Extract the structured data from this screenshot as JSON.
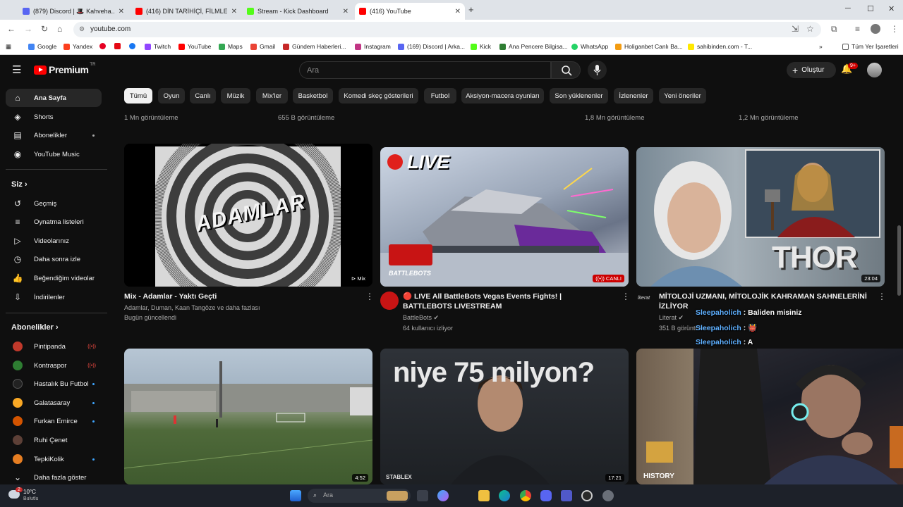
{
  "browser": {
    "tabs": [
      {
        "title": "(879) Discord | 🎩 Kahveha...",
        "color": "#5865f2",
        "active": false
      },
      {
        "title": "(416) DİN TARİHİÇİ, FİLMLERİ...",
        "color": "#ff0000",
        "active": false
      },
      {
        "title": "Stream - Kick Dashboard",
        "color": "#53fc18",
        "active": false
      },
      {
        "title": "(416) YouTube",
        "color": "#ff0000",
        "active": true
      }
    ],
    "new_tab": "+",
    "url": "youtube.com",
    "bookmarks": [
      {
        "label": "Google",
        "color": "#4285f4"
      },
      {
        "label": "Yandex",
        "color": "#fc3f1d"
      },
      {
        "label": "",
        "color": "#e60023"
      },
      {
        "label": "",
        "color": "#e50914"
      },
      {
        "label": "",
        "color": "#1877f2"
      },
      {
        "label": "Twitch",
        "color": "#9146ff"
      },
      {
        "label": "YouTube",
        "color": "#ff0000"
      },
      {
        "label": "Maps",
        "color": "#34a853"
      },
      {
        "label": "Gmail",
        "color": "#ea4335"
      },
      {
        "label": "Gündem Haberleri...",
        "color": "#c62828"
      },
      {
        "label": "Instagram",
        "color": "#c13584"
      },
      {
        "label": "(169) Discord | Arka...",
        "color": "#5865f2"
      },
      {
        "label": "Kick",
        "color": "#53fc18"
      },
      {
        "label": "Ana Pencere Bilgisa...",
        "color": "#2e7d32"
      },
      {
        "label": "WhatsApp",
        "color": "#25d366"
      },
      {
        "label": "Holiganbet Canlı Ba...",
        "color": "#f39c12"
      },
      {
        "label": "sahibinden.com - T...",
        "color": "#ffe800"
      }
    ],
    "all_bookmarks": "Tüm Yer İşaretleri"
  },
  "header": {
    "logo": "Premium",
    "logo_sup": "TR",
    "search_placeholder": "Ara",
    "create_label": "Oluştur",
    "notif_count": "9+"
  },
  "chips": [
    "Tümü",
    "Oyun",
    "Canlı",
    "Müzik",
    "Mix'ler",
    "Basketbol",
    "Komedi skeç gösterileri",
    "Futbol",
    "Aksiyon-macera oyunları",
    "Son yüklenenler",
    "İzlenenler",
    "Yeni öneriler"
  ],
  "sidebar": {
    "main": [
      "Ana Sayfa",
      "Shorts",
      "Abonelikler",
      "YouTube Music"
    ],
    "you_header": "Siz",
    "you": [
      "Geçmiş",
      "Oynatma listeleri",
      "Videolarınız",
      "Daha sonra izle",
      "Beğendiğim videolar",
      "İndirilenler"
    ],
    "subs_header": "Abonelikler",
    "subs": [
      {
        "name": "Pintipanda",
        "status": "live",
        "color": "#c0392b"
      },
      {
        "name": "Kontraspor",
        "status": "live",
        "color": "#2e7d32"
      },
      {
        "name": "Hastalık Bu Futbol",
        "status": "dot",
        "color": "#222222"
      },
      {
        "name": "Galatasaray",
        "status": "dot",
        "color": "#f9a825"
      },
      {
        "name": "Furkan Emirce",
        "status": "dot",
        "color": "#d35400"
      },
      {
        "name": "Ruhi Çenet",
        "status": "",
        "color": "#5d4037"
      },
      {
        "name": "TepkiKolik",
        "status": "dot",
        "color": "#e67e22"
      }
    ],
    "more": "Daha fazla göster"
  },
  "top_row_views": [
    "1 Mn görüntüleme",
    "655 B görüntüleme",
    "1,8 Mn görüntüleme",
    "1,2 Mn görüntüleme"
  ],
  "videos": [
    {
      "title": "Mix - Adamlar - Yaktı Geçti",
      "line2": "Adamlar, Duman, Kaan Tangöze ve daha fazlası",
      "line3": "Bugün güncellendi",
      "badge": "Mix",
      "thumb_text": "ADAMLAR"
    },
    {
      "title": "🔴 LIVE All BattleBots Vegas Events Fights! | BATTLEBOTS LIVESTREAM",
      "line2": "BattleBots",
      "line3": "64 kullanıcı izliyor",
      "badge": "CANLI",
      "thumb_text": "LIVE",
      "logo_text": "BATTLEBOTS"
    },
    {
      "title": "MİTOLOJİ UZMANI, MİTOLOJİK KAHRAMAN SAHNELERİNİ İZLİYOR",
      "line2": "Literat",
      "line3": "351 B görüntüleme",
      "badge": "23:04",
      "thumb_text": "THOR",
      "channel_mark": "literat"
    },
    {
      "badge": "4:52"
    },
    {
      "badge": "17:21",
      "thumb_text": "niye 75 milyon?",
      "logo_text": "STABLEX"
    },
    {
      "thumb_text": "HISTORY"
    }
  ],
  "chat": [
    {
      "user": "Sleepaholich",
      "msg": "Baliden misiniz"
    },
    {
      "user": "Sleepaholich",
      "msg": "👹"
    },
    {
      "user": "Sleepaholich",
      "msg": "A"
    }
  ],
  "taskbar": {
    "temp": "10°C",
    "weather": "Bulutlu",
    "weather_badge": "2",
    "search": "Ara"
  }
}
